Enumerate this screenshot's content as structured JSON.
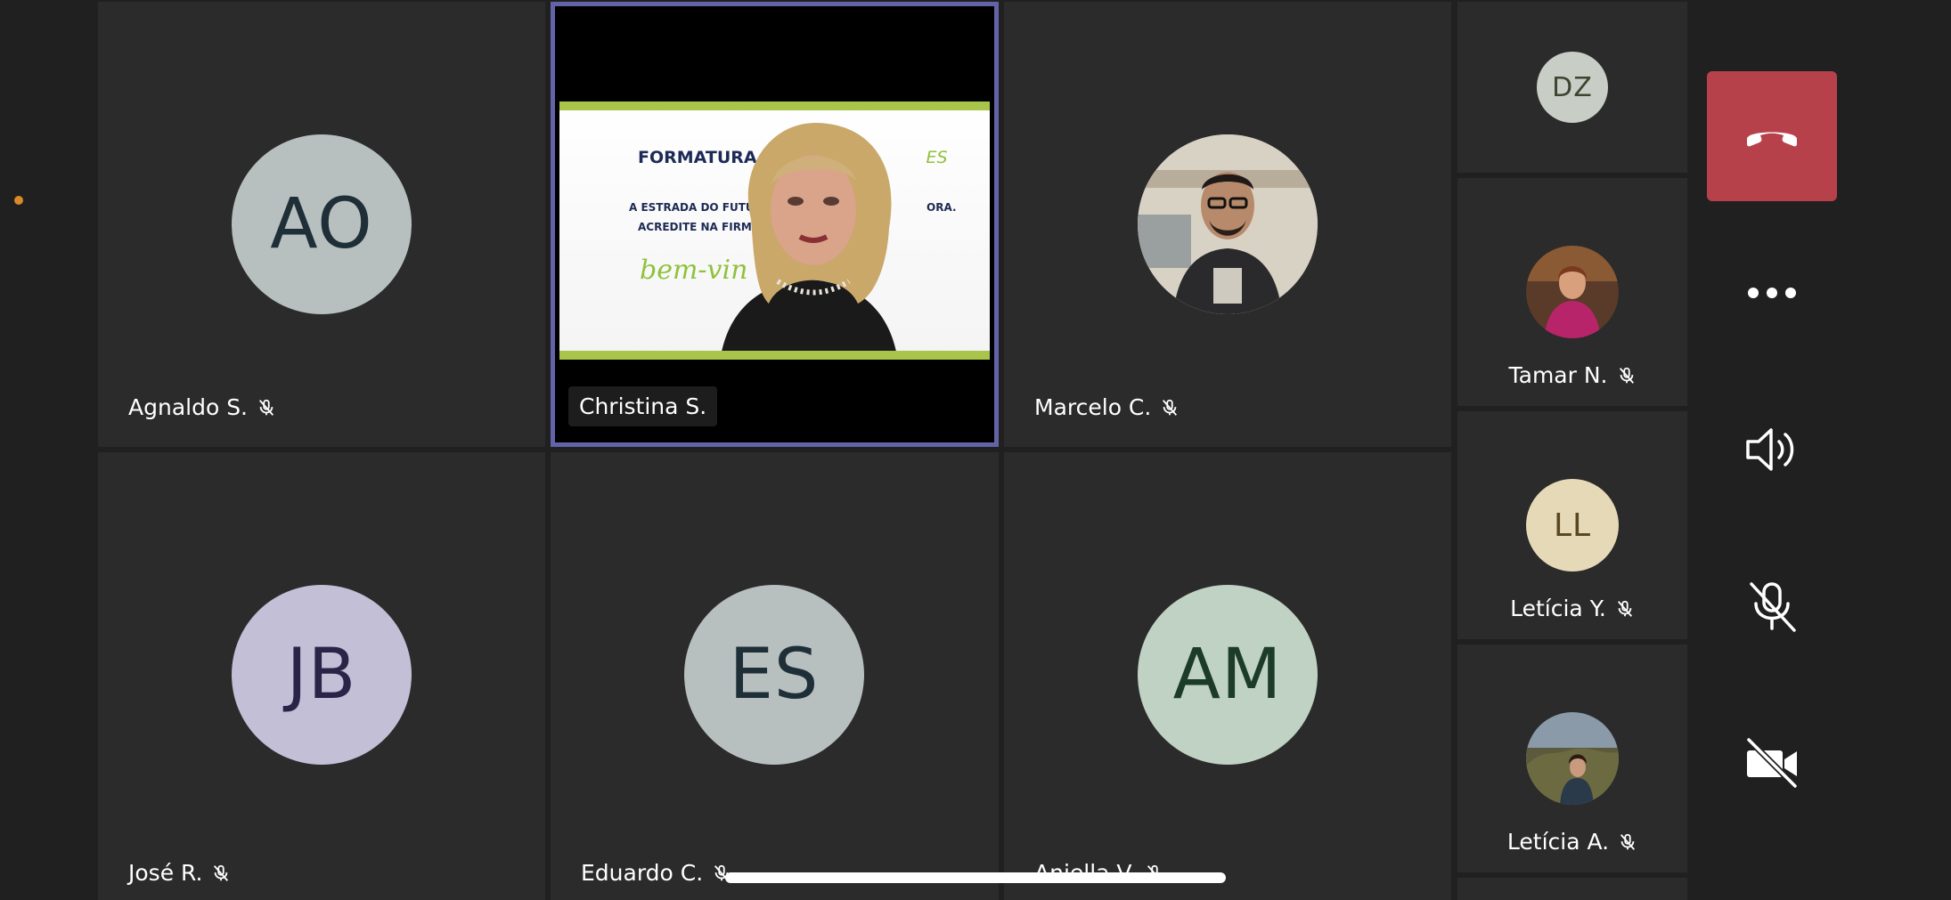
{
  "call": {
    "participants_grid": [
      {
        "initials": "AO",
        "name": "Agnaldo S.",
        "muted": true,
        "avatar_bg": "#b8bfbf",
        "avatar_fg": "#1f2f38"
      },
      {
        "initials": "",
        "name": "Christina S.",
        "muted": false,
        "active": true
      },
      {
        "initials": "",
        "name": "Marcelo C.",
        "muted": true
      },
      {
        "initials": "JB",
        "name": "José R.",
        "muted": true,
        "avatar_bg": "#c3bfd6",
        "avatar_fg": "#2a2448"
      },
      {
        "initials": "ES",
        "name": "Eduardo C.",
        "muted": true,
        "avatar_bg": "#b8bfbf",
        "avatar_fg": "#1f2f38"
      },
      {
        "initials": "AM",
        "name": "Aniella V.",
        "muted": true,
        "avatar_bg": "#bfd2c3",
        "avatar_fg": "#1d3b2a"
      }
    ],
    "side_participants": [
      {
        "initials": "DZ",
        "name": "",
        "muted": false,
        "avatar_bg": "#c8cdc6",
        "avatar_fg": "#3b4630"
      },
      {
        "initials": "",
        "name": "Tamar N.",
        "muted": true
      },
      {
        "initials": "LL",
        "name": "Letícia Y.",
        "muted": true,
        "avatar_bg": "#e6d9b8",
        "avatar_fg": "#5a4820"
      },
      {
        "initials": "",
        "name": "Letícia A.",
        "muted": true
      }
    ],
    "shared_slide": {
      "title": "FORMATURA 2",
      "title_suffix": "ES",
      "line1": "A ESTRADA DO FUTURO",
      "line1_end": "ORA.",
      "line2": "ACREDITE NA FIRMEZ",
      "greeting": "bem-vin"
    }
  },
  "controls": {
    "hangup": "hang-up",
    "more": "more-options",
    "speaker": "speaker",
    "mic": "microphone-off",
    "camera": "camera-off"
  },
  "colors": {
    "active_border": "#6264a7",
    "hangup": "#b7414a",
    "tile_bg": "#2b2b2b",
    "page_bg": "#202020"
  }
}
